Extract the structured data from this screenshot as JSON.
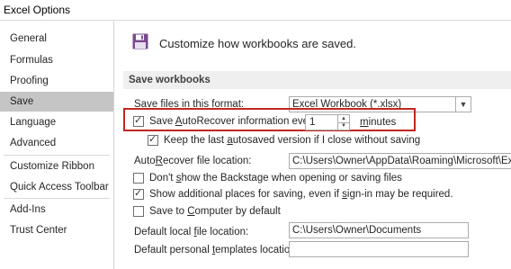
{
  "window": {
    "title": "Excel Options"
  },
  "sidebar": {
    "items": [
      {
        "label": "General"
      },
      {
        "label": "Formulas"
      },
      {
        "label": "Proofing"
      },
      {
        "label": "Save"
      },
      {
        "label": "Language"
      },
      {
        "label": "Advanced"
      },
      {
        "label": "Customize Ribbon"
      },
      {
        "label": "Quick Access Toolbar"
      },
      {
        "label": "Add-Ins"
      },
      {
        "label": "Trust Center"
      }
    ],
    "selected": "Save"
  },
  "header": {
    "text": "Customize how workbooks are saved.",
    "icon": "floppy-disk-icon"
  },
  "section": {
    "title": "Save workbooks"
  },
  "format": {
    "label_pre": "Save files in this ",
    "label_u": "f",
    "label_post": "ormat:",
    "value": "Excel Workbook (*.xlsx)"
  },
  "autorecover": {
    "label_pre": "Save ",
    "label_u": "A",
    "label_post": "utoRecover information every",
    "checked": true,
    "minutes_value": "1",
    "minutes_pre": "",
    "minutes_u": "m",
    "minutes_post": "inutes"
  },
  "keep_last": {
    "label_pre": "Keep the last ",
    "label_u": "a",
    "label_post": "utosaved version if I close without saving",
    "checked": true
  },
  "ar_location": {
    "label_pre": "Auto",
    "label_u": "R",
    "label_post": "ecover file location:",
    "value": "C:\\Users\\Owner\\AppData\\Roaming\\Microsoft\\Excel\\"
  },
  "backstage": {
    "label_pre": "Don't ",
    "label_u": "s",
    "label_post": "how the Backstage when opening or saving files",
    "checked": false
  },
  "additional_places": {
    "label_pre": "Show additional places for saving, even if ",
    "label_u": "s",
    "label_post": "ign-in may be required.",
    "checked": true
  },
  "save_computer": {
    "label_pre": "Save to ",
    "label_u": "C",
    "label_post": "omputer by default",
    "checked": false
  },
  "local_file": {
    "label_pre": "Default local ",
    "label_u": "f",
    "label_post": "ile location:",
    "value": "C:\\Users\\Owner\\Documents"
  },
  "personal_templates": {
    "label_pre": "Default personal ",
    "label_u": "t",
    "label_post": "emplates location:",
    "value": ""
  },
  "colors": {
    "highlight_box": "#c0281f",
    "selected_nav": "#c5c5c5"
  }
}
